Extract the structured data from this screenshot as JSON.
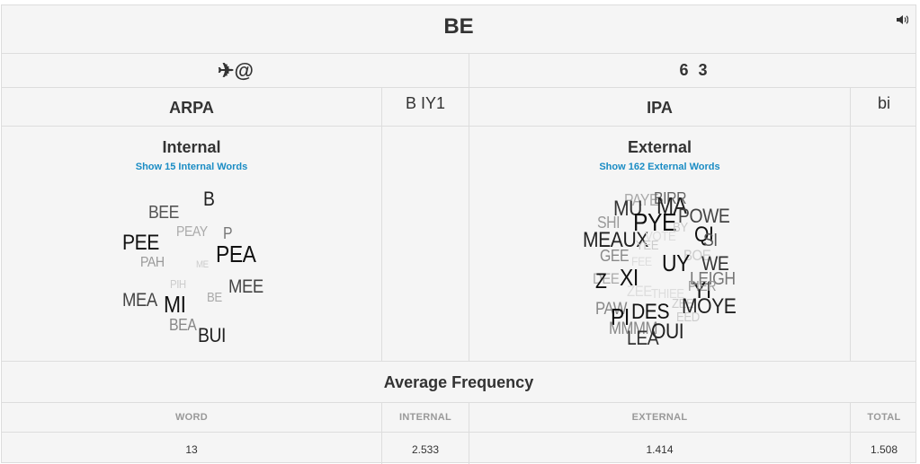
{
  "word": "BE",
  "speaker_icon": "speaker-icon",
  "symbols": {
    "left": "✈@",
    "right": "6 3"
  },
  "arpa": {
    "label": "ARPA",
    "value": "B IY1"
  },
  "ipa": {
    "label": "IPA",
    "value": "bi"
  },
  "internal": {
    "heading": "Internal",
    "link": "Show 15 Internal Words",
    "words": [
      {
        "t": "B",
        "c": "#222"
      },
      {
        "t": "BEE",
        "c": "#555"
      },
      {
        "t": "PEAY",
        "c": "#aaa"
      },
      {
        "t": "P",
        "c": "#777"
      },
      {
        "t": "PEE",
        "c": "#111"
      },
      {
        "t": "PEA",
        "c": "#111"
      },
      {
        "t": "PAH",
        "c": "#999"
      },
      {
        "t": "ME",
        "c": "#ccc"
      },
      {
        "t": "PIH",
        "c": "#ccc"
      },
      {
        "t": "MEE",
        "c": "#444"
      },
      {
        "t": "BE",
        "c": "#aaa"
      },
      {
        "t": "MEA",
        "c": "#444"
      },
      {
        "t": "MI",
        "c": "#111"
      },
      {
        "t": "BEA",
        "c": "#888"
      },
      {
        "t": "BUI",
        "c": "#222"
      }
    ]
  },
  "external": {
    "heading": "External",
    "link": "Show 162 External Words",
    "words": [
      {
        "t": "PAYE",
        "c": "#aaa"
      },
      {
        "t": "BIRR",
        "c": "#666"
      },
      {
        "t": "MU",
        "c": "#333"
      },
      {
        "t": "MA",
        "c": "#222"
      },
      {
        "t": "POWE",
        "c": "#444"
      },
      {
        "t": "SHI",
        "c": "#999"
      },
      {
        "t": "PYE",
        "c": "#111"
      },
      {
        "t": "BY",
        "c": "#ccc"
      },
      {
        "t": "QI",
        "c": "#111"
      },
      {
        "t": "MEAUX",
        "c": "#222"
      },
      {
        "t": "VOTE",
        "c": "#ddd"
      },
      {
        "t": "SI",
        "c": "#555"
      },
      {
        "t": "GEE",
        "c": "#888"
      },
      {
        "t": "YEE",
        "c": "#ccc"
      },
      {
        "t": "BOE",
        "c": "#ccc"
      },
      {
        "t": "FEE",
        "c": "#ddd"
      },
      {
        "t": "UY",
        "c": "#111"
      },
      {
        "t": "WE",
        "c": "#333"
      },
      {
        "t": "XI",
        "c": "#111"
      },
      {
        "t": "LEIGH",
        "c": "#777"
      },
      {
        "t": "DEE",
        "c": "#aaa"
      },
      {
        "t": "Z",
        "c": "#111"
      },
      {
        "t": "ZEE",
        "c": "#ddd"
      },
      {
        "t": "YI",
        "c": "#111"
      },
      {
        "t": "PIER",
        "c": "#999"
      },
      {
        "t": "THIEE",
        "c": "#ddd"
      },
      {
        "t": "ZEE",
        "c": "#ccc"
      },
      {
        "t": "MOYE",
        "c": "#222"
      },
      {
        "t": "PAW",
        "c": "#888"
      },
      {
        "t": "PI",
        "c": "#111"
      },
      {
        "t": "DES",
        "c": "#111"
      },
      {
        "t": "EED",
        "c": "#ccc"
      },
      {
        "t": "MMMM",
        "c": "#888"
      },
      {
        "t": "OUI",
        "c": "#222"
      },
      {
        "t": "LEA",
        "c": "#333"
      }
    ]
  },
  "frequency": {
    "title": "Average Frequency",
    "headers": [
      "WORD",
      "INTERNAL",
      "EXTERNAL",
      "TOTAL"
    ],
    "values": [
      "13",
      "2.533",
      "1.414",
      "1.508"
    ]
  }
}
